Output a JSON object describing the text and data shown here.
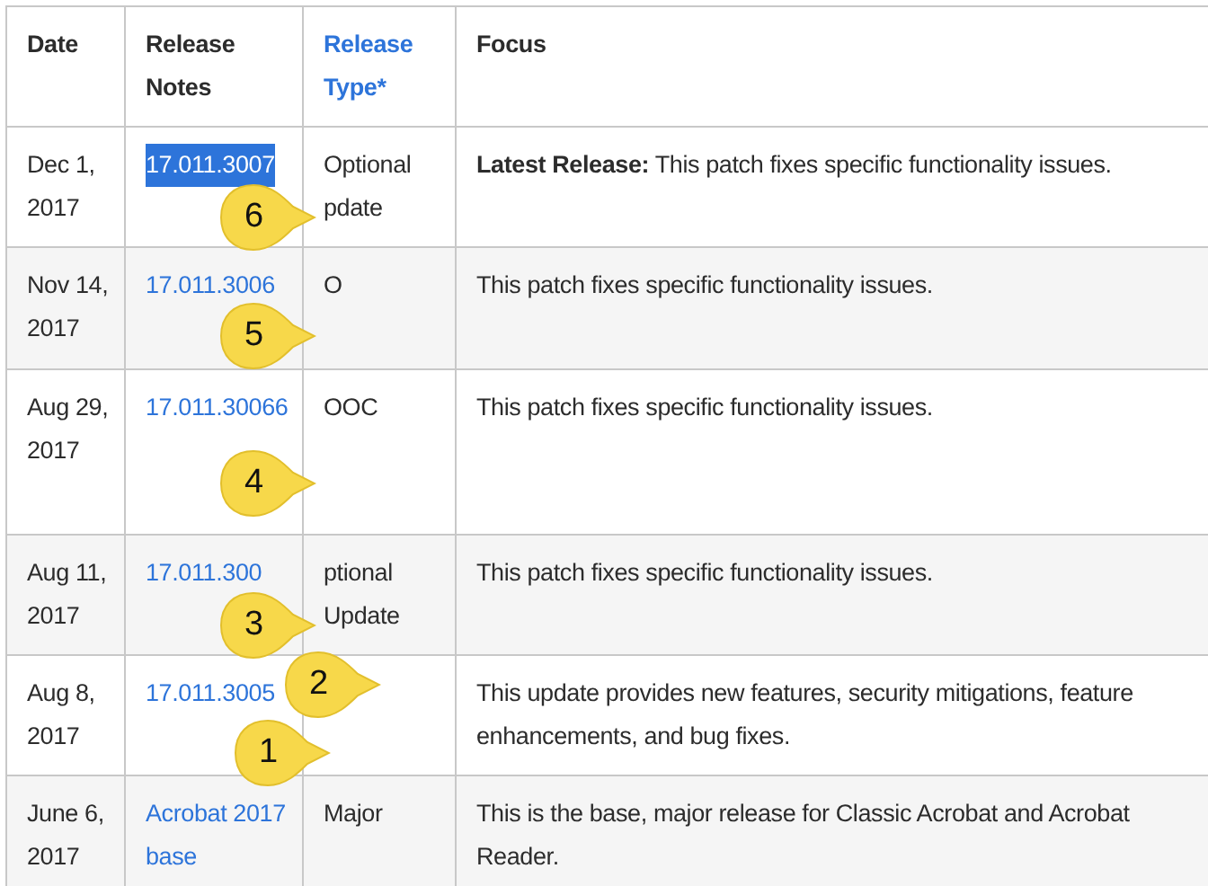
{
  "table": {
    "columns": [
      {
        "label": "Date",
        "link": false
      },
      {
        "label": "Release Notes",
        "link": false
      },
      {
        "label": "Release Type*",
        "link": true
      },
      {
        "label": "Focus",
        "link": false
      }
    ],
    "rows": [
      {
        "date": "Dec 1, 2017",
        "notes": "17.011.3007",
        "highlighted": true,
        "type": "Optional pdate",
        "focus": "**Latest Release:** This patch fixes specific functionality issues."
      },
      {
        "date": "Nov 14, 2017",
        "notes": "17.011.3006",
        "highlighted": false,
        "type": "O",
        "focus": "This patch fixes specific functionality issues."
      },
      {
        "date": "Aug 29, 2017",
        "notes": "17.011.30066",
        "highlighted": false,
        "type": "OOC",
        "focus": "This patch fixes specific functionality issues."
      },
      {
        "date": "Aug 11, 2017",
        "notes": "17.011.300",
        "highlighted": false,
        "type": "ptional Update",
        "focus": "This patch fixes specific functionality issues."
      },
      {
        "date": "Aug 8, 2017",
        "notes": "17.011.3005",
        "highlighted": false,
        "focus": "This update provides new features, security mitigations, feature enhancements, and bug fixes."
      },
      {
        "date": "June 6, 2017",
        "notes": "Acrobat 2017 base",
        "highlighted": false,
        "type": "Major",
        "focus": "This is the base, major release for Classic Acrobat and Acrobat Reader."
      }
    ]
  },
  "callouts": [
    {
      "label": "6"
    },
    {
      "label": "5"
    },
    {
      "label": "4"
    },
    {
      "label": "3"
    },
    {
      "label": "2"
    },
    {
      "label": "1"
    }
  ]
}
